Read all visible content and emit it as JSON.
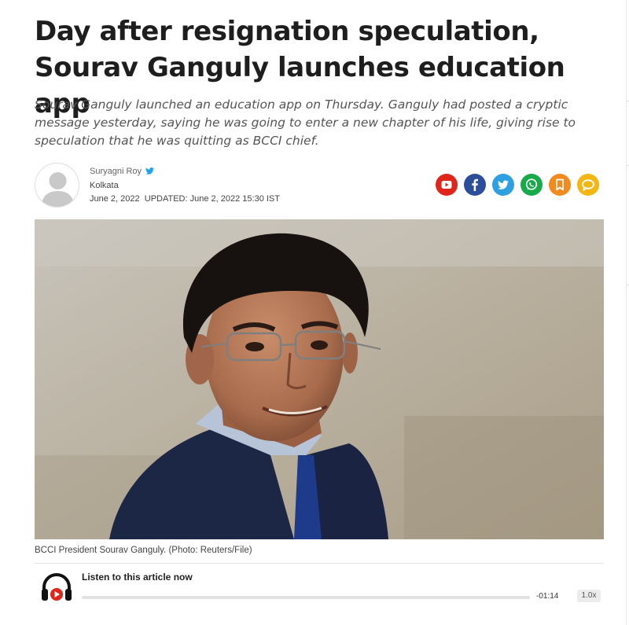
{
  "article": {
    "headline": "Day after resignation speculation, Sourav Ganguly launches education app",
    "summary": "Sourav Ganguly launched an education app on Thursday. Ganguly had posted a cryptic message yesterday, saying he was going to enter a new chapter of his life, giving rise to speculation that he was quitting as BCCI chief."
  },
  "byline": {
    "author": "Suryagni Roy",
    "location": "Kolkata",
    "date": "June 2, 2022",
    "updated_label": "UPDATED:",
    "updated": "June 2, 2022 15:30 IST"
  },
  "share": {
    "icons": [
      "youtube-icon",
      "facebook-icon",
      "twitter-icon",
      "whatsapp-icon",
      "bookmark-icon",
      "comment-icon"
    ],
    "colors": {
      "youtube": "#e0251b",
      "facebook": "#2c4d9a",
      "twitter": "#2e9fe0",
      "whatsapp": "#17a94a",
      "bookmark": "#f28a1d",
      "comment": "#f3b613"
    }
  },
  "photo": {
    "caption": "BCCI President Sourav Ganguly. (Photo: Reuters/File)"
  },
  "audio_player": {
    "title": "Listen to this article now",
    "time_remaining": "-01:14",
    "speed": "1.0x",
    "progress": 0
  }
}
